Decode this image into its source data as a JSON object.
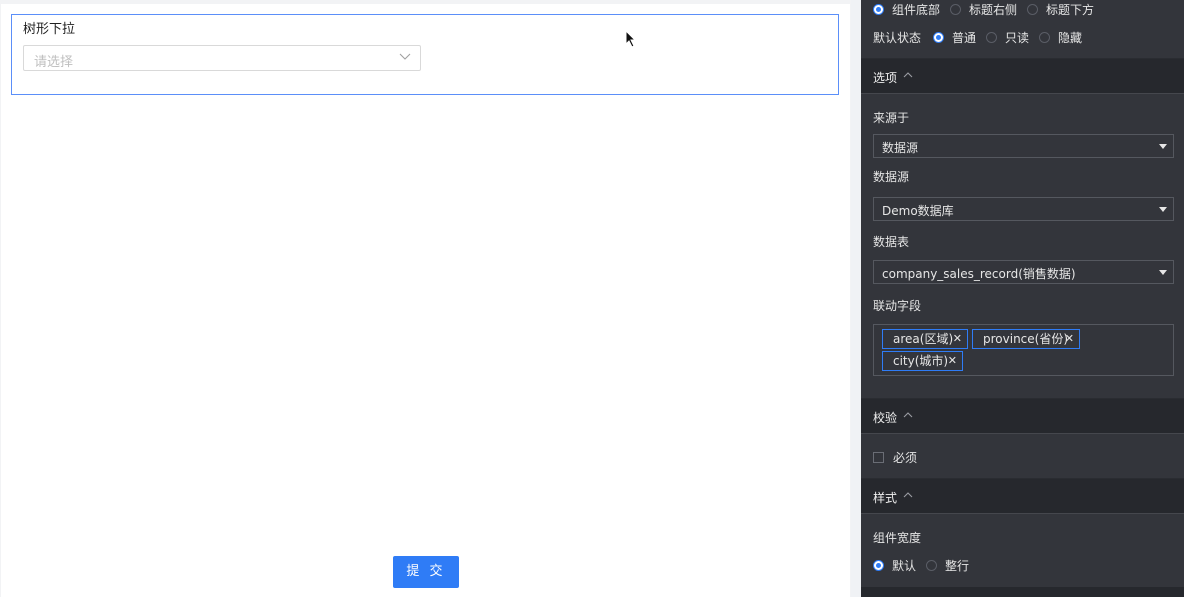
{
  "canvas": {
    "widget_title": "树形下拉",
    "tree_select_placeholder": "请选择",
    "submit_label": "提 交"
  },
  "panel": {
    "title_position": {
      "options": [
        "组件底部",
        "标题右侧",
        "标题下方"
      ],
      "selected": "组件底部"
    },
    "default_state": {
      "label": "默认状态",
      "options": [
        "普通",
        "只读",
        "隐藏"
      ],
      "selected": "普通"
    },
    "options_section": {
      "title": "选项",
      "source_label": "来源于",
      "source_value": "数据源",
      "datasource_label": "数据源",
      "datasource_value": "Demo数据库",
      "table_label": "数据表",
      "table_value": "company_sales_record(销售数据)",
      "linked_fields_label": "联动字段",
      "linked_fields": [
        "area(区域)",
        "province(省份)",
        "city(城市)"
      ]
    },
    "validation_section": {
      "title": "校验",
      "required_label": "必须",
      "required_checked": false
    },
    "style_section": {
      "title": "样式",
      "width_label": "组件宽度",
      "width_options": [
        "默认",
        "整行"
      ],
      "width_selected": "默认"
    },
    "colors": {
      "accent": "#2f7cf6",
      "panel_bg": "#33353b",
      "section_bg": "#26282d"
    }
  }
}
